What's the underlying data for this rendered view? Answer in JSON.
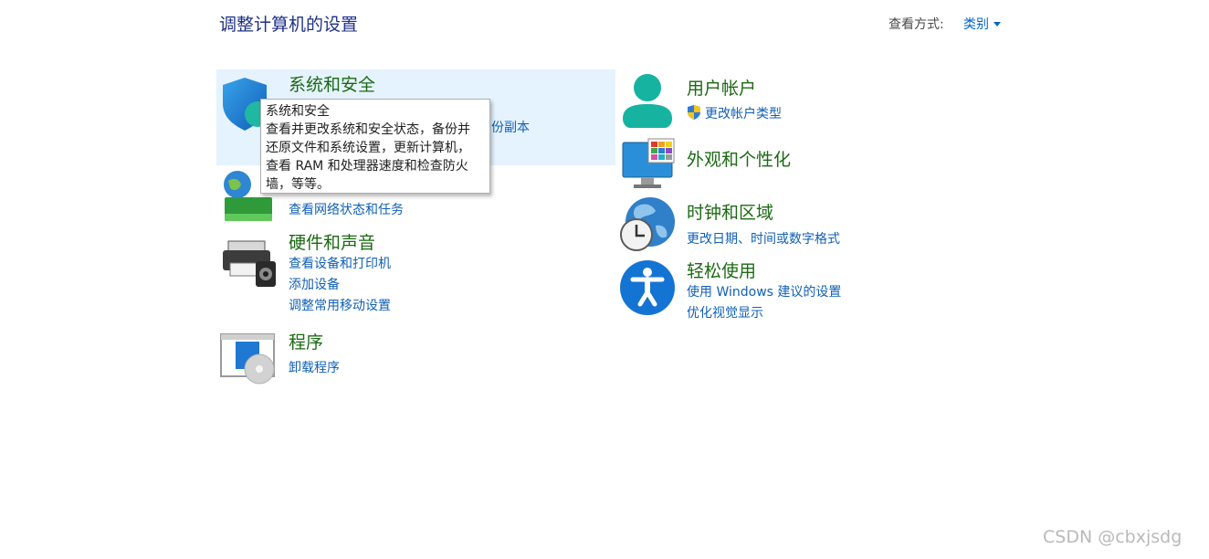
{
  "header": {
    "title": "调整计算机的设置",
    "view_by_label": "查看方式:",
    "view_by_value": "类别"
  },
  "categories": {
    "system_security": {
      "title": "系统和安全",
      "link_backup_tail": "份副本",
      "icon": "shield-icon"
    },
    "network": {
      "link_status": "查看网络状态和任务",
      "icon": "network-globe-icon"
    },
    "hardware": {
      "title": "硬件和声音",
      "links": [
        "查看设备和打印机",
        "添加设备",
        "调整常用移动设置"
      ],
      "icon": "printer-icon"
    },
    "programs": {
      "title": "程序",
      "links": [
        "卸载程序"
      ],
      "icon": "programs-icon"
    },
    "user_accounts": {
      "title": "用户帐户",
      "links": [
        "更改帐户类型"
      ],
      "icon": "user-icon"
    },
    "appearance": {
      "title": "外观和个性化",
      "icon": "monitor-icon"
    },
    "clock_region": {
      "title": "时钟和区域",
      "links": [
        "更改日期、时间或数字格式"
      ],
      "icon": "clock-globe-icon"
    },
    "ease_access": {
      "title": "轻松使用",
      "links": [
        "使用 Windows 建议的设置",
        "优化视觉显示"
      ],
      "icon": "accessibility-icon"
    }
  },
  "tooltip": {
    "lines": [
      "系统和安全",
      "查看并更改系统和安全状态，备份并",
      "还原文件和系统设置，更新计算机，",
      "查看 RAM 和处理器速度和检查防火",
      "墙，等等。"
    ]
  },
  "watermark": "CSDN @cbxjsdg",
  "colors": {
    "title_blue": "#1e3287",
    "category_green": "#1c6a14",
    "link_blue": "#1060b5",
    "highlight": "#e5f3fe"
  }
}
